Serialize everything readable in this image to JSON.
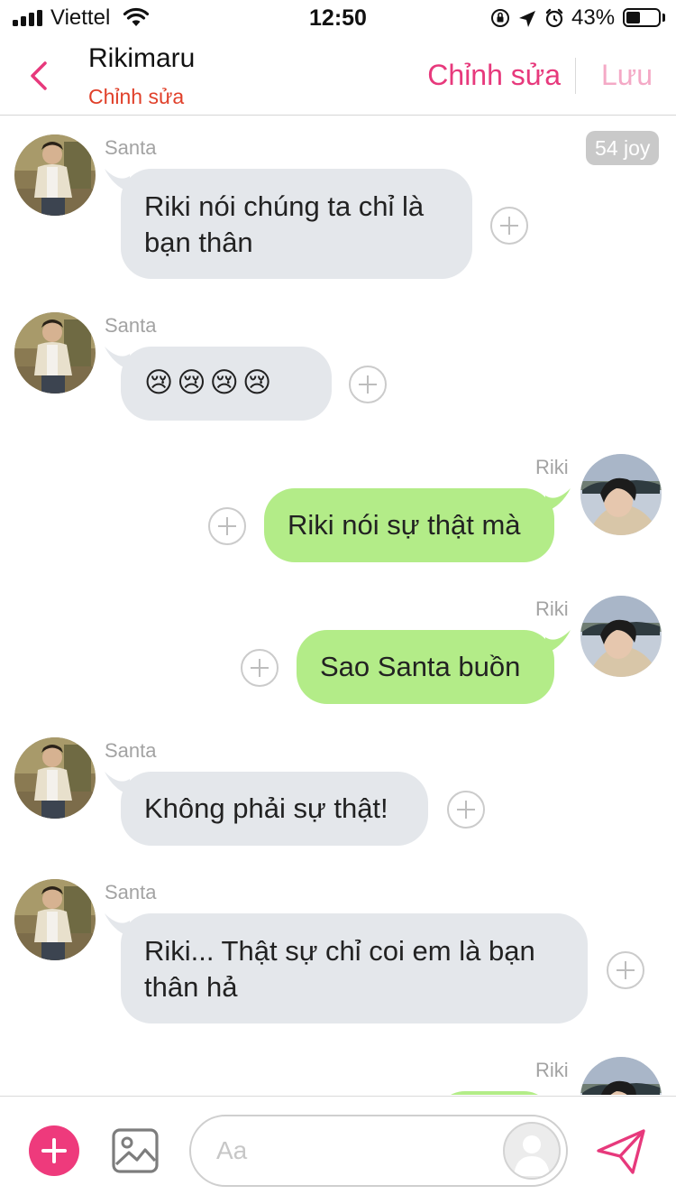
{
  "status_bar": {
    "carrier": "Viettel",
    "time": "12:50",
    "battery_percent": "43%",
    "battery_level": 0.43,
    "icons": [
      "signal-icon",
      "wifi-icon",
      "orientation-lock-icon",
      "location-arrow-icon",
      "alarm-icon",
      "battery-icon"
    ]
  },
  "header": {
    "title": "Rikimaru",
    "subtitle": "Chỉnh sửa",
    "edit_label": "Chỉnh sửa",
    "save_label": "Lưu",
    "back_icon": "chevron-left-icon"
  },
  "chat": {
    "joy_badge": "54 joy",
    "messages": [
      {
        "sender": "Santa",
        "side": "incoming",
        "text": "Riki nói chúng ta chỉ là\nbạn thân"
      },
      {
        "sender": "Santa",
        "side": "incoming",
        "text": "😢😢😢😢"
      },
      {
        "sender": "Riki",
        "side": "outgoing",
        "text": "Riki nói sự thật mà"
      },
      {
        "sender": "Riki",
        "side": "outgoing",
        "text": "Sao Santa buồn"
      },
      {
        "sender": "Santa",
        "side": "incoming",
        "text": "Không phải sự thật!"
      },
      {
        "sender": "Santa",
        "side": "incoming",
        "text": "Riki... Thật sự chỉ coi em là bạn\nthân hả"
      },
      {
        "sender": "Riki",
        "side": "outgoing",
        "text": ""
      }
    ]
  },
  "composer": {
    "placeholder": "Aa",
    "icons": [
      "plus-icon",
      "image-icon",
      "speaker-avatar-icon",
      "send-icon"
    ]
  },
  "colors": {
    "accent": "#e7397c",
    "subtitle": "#e0402a",
    "incoming_bubble": "#e4e7eb",
    "outgoing_bubble": "#b3ec88"
  }
}
